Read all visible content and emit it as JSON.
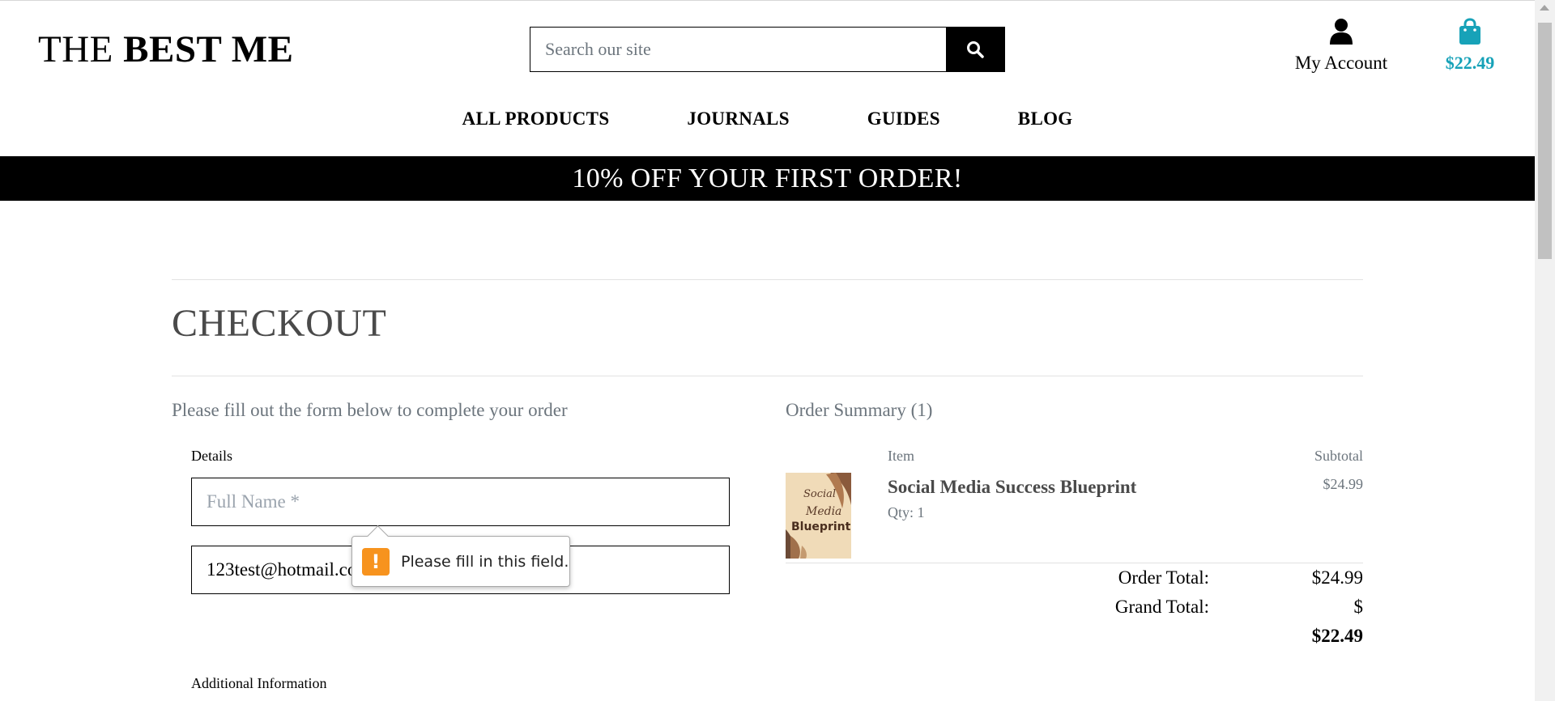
{
  "header": {
    "logo_light": "THE ",
    "logo_bold": "BEST ME",
    "search_placeholder": "Search our site",
    "account_label": "My Account",
    "bag_total": "$22.49"
  },
  "nav": {
    "items": [
      {
        "label": "ALL PRODUCTS"
      },
      {
        "label": "JOURNALS"
      },
      {
        "label": "GUIDES"
      },
      {
        "label": "BLOG"
      }
    ]
  },
  "banner": {
    "text": "10% OFF YOUR FIRST ORDER!"
  },
  "checkout": {
    "title": "CHECKOUT",
    "form_intro": "Please fill out the form below to complete your order",
    "details_label": "Details",
    "full_name_placeholder": "Full Name *",
    "email_value": "123test@hotmail.com",
    "additional_label": "Additional Information",
    "validation_message": "Please fill in this field.",
    "validation_icon_glyph": "!"
  },
  "summary": {
    "title": "Order Summary (1)",
    "col_item": "Item",
    "col_subtotal": "Subtotal",
    "product": {
      "name": "Social Media Success Blueprint",
      "qty": "Qty: 1",
      "subtotal": "$24.99",
      "thumb_text": [
        "Social",
        "Media",
        "Blueprint"
      ]
    },
    "order_total_label": "Order Total:",
    "order_total_value": "$24.99",
    "grand_total_label": "Grand Total:",
    "grand_total_currency": "$",
    "grand_total_amount": "$22.49"
  },
  "colors": {
    "accent": "#17a2b8",
    "banner_bg": "#000000",
    "muted_text": "#6c757d",
    "warning": "#f7931e"
  },
  "icons": {
    "search": "search-icon",
    "account": "user-icon",
    "bag": "shopping-bag-icon",
    "warning": "warning-icon"
  }
}
